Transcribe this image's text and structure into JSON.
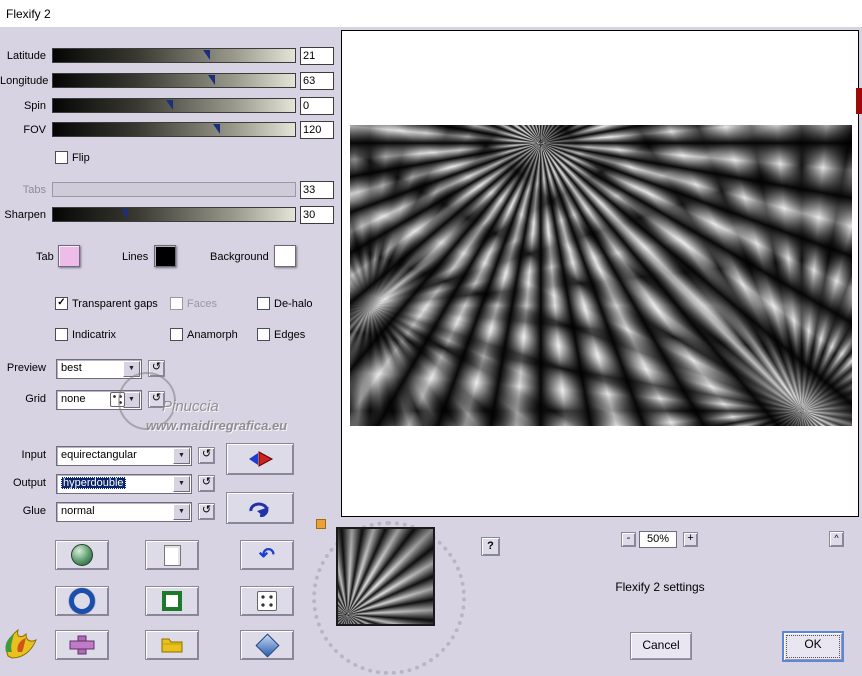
{
  "window": {
    "title": "Flexify 2"
  },
  "sliders": [
    {
      "label": "Latitude",
      "value": "21"
    },
    {
      "label": "Longitude",
      "value": "63"
    },
    {
      "label": "Spin",
      "value": "0"
    },
    {
      "label": "FOV",
      "value": "120"
    },
    {
      "label": "Tabs",
      "value": "33"
    },
    {
      "label": "Sharpen",
      "value": "30"
    }
  ],
  "flip": {
    "label": "Flip",
    "mark": ""
  },
  "swatches": {
    "tab": {
      "label": "Tab",
      "color": "#eebcE8"
    },
    "lines": {
      "label": "Lines",
      "color": "#000000"
    },
    "background": {
      "label": "Background",
      "color": "#ffffff"
    }
  },
  "checks": [
    {
      "label": "Transparent gaps",
      "mark": "✓"
    },
    {
      "label": "Faces",
      "mark": ""
    },
    {
      "label": "De-halo",
      "mark": ""
    },
    {
      "label": "Indicatrix",
      "mark": ""
    },
    {
      "label": "Anamorph",
      "mark": ""
    },
    {
      "label": "Edges",
      "mark": ""
    }
  ],
  "dropdown_rows": {
    "preview": {
      "label": "Preview",
      "value": "best"
    },
    "grid": {
      "label": "Grid",
      "value": "none"
    },
    "input": {
      "label": "Input",
      "value": "equirectangular"
    },
    "output": {
      "label": "Output",
      "value": "hyperdouble"
    },
    "glue": {
      "label": "Glue",
      "value": "normal"
    }
  },
  "watermark": {
    "name": "Pinuccia",
    "url": "www.maidiregrafica.eu"
  },
  "help_label": "?",
  "zoom": {
    "minus": "-",
    "level": "50%",
    "plus": "+"
  },
  "scroll": {
    "up_arrow": "^"
  },
  "footer": {
    "settings_text": "Flexify 2 settings",
    "cancel_label": "Cancel",
    "ok_label": "OK"
  },
  "icons": {
    "reset_glyph": "↺",
    "dropdown_arrow": "▼",
    "undo_glyph": "↶"
  },
  "colors": {
    "panel_bg": "#d7d3e2",
    "highlight": "#0a246a",
    "accent_red": "#9c0a0a"
  }
}
